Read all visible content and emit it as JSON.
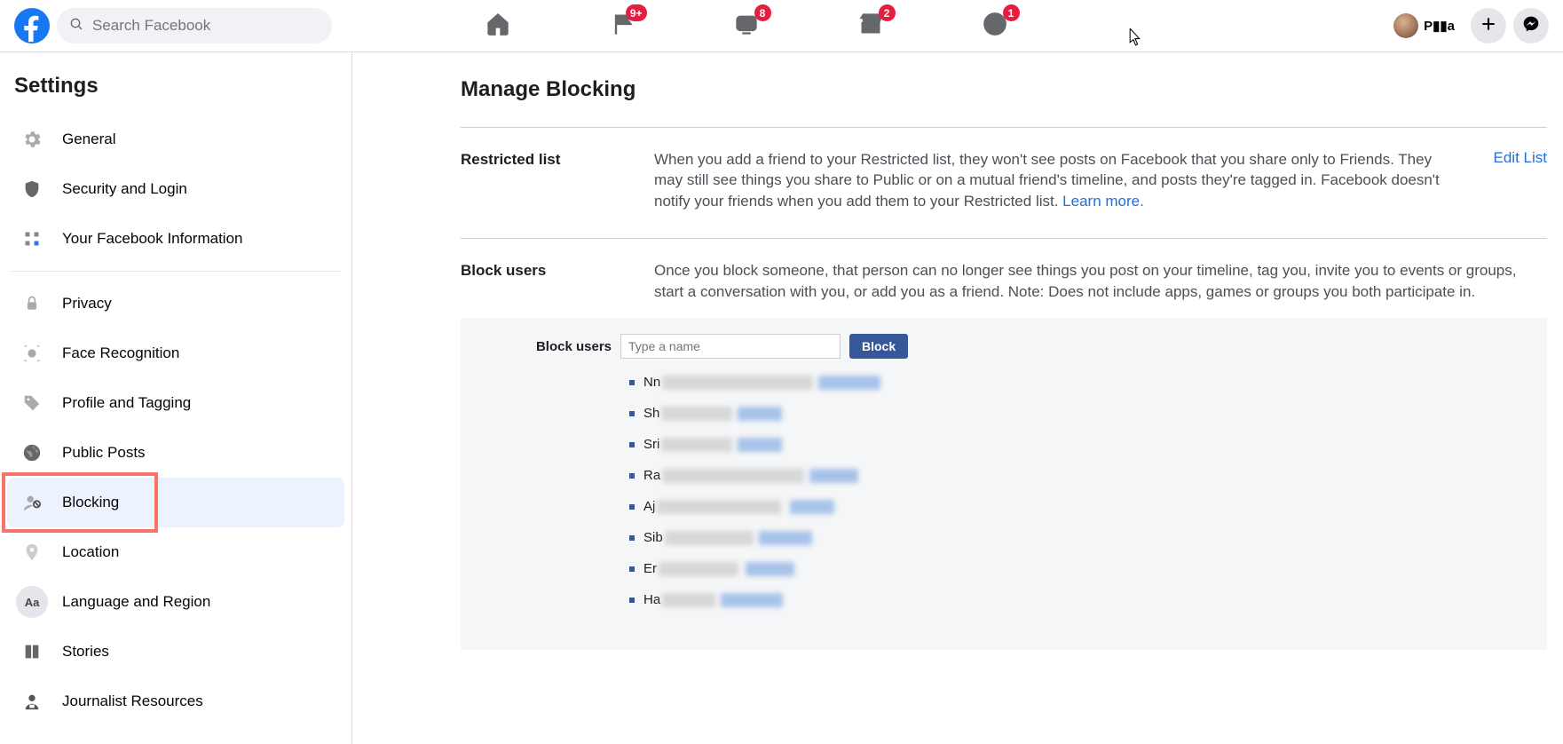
{
  "header": {
    "search_placeholder": "Search Facebook",
    "badges": {
      "pages": "9+",
      "watch": "8",
      "marketplace": "2",
      "groups": "1"
    },
    "profile_name": "P▮▮a"
  },
  "sidebar": {
    "title": "Settings",
    "items": [
      {
        "label": "General"
      },
      {
        "label": "Security and Login"
      },
      {
        "label": "Your Facebook Information"
      },
      {
        "label": "Privacy"
      },
      {
        "label": "Face Recognition"
      },
      {
        "label": "Profile and Tagging"
      },
      {
        "label": "Public Posts"
      },
      {
        "label": "Blocking"
      },
      {
        "label": "Location"
      },
      {
        "label": "Language and Region"
      },
      {
        "label": "Stories"
      },
      {
        "label": "Journalist Resources"
      }
    ]
  },
  "main": {
    "title": "Manage Blocking",
    "restricted": {
      "label": "Restricted list",
      "desc": "When you add a friend to your Restricted list, they won't see posts on Facebook that you share only to Friends. They may still see things you share to Public or on a mutual friend's timeline, and posts they're tagged in. Facebook doesn't notify your friends when you add them to your Restricted list. ",
      "learn_more": "Learn more.",
      "action": "Edit List"
    },
    "block_users": {
      "label": "Block users",
      "desc": "Once you block someone, that person can no longer see things you post on your timeline, tag you, invite you to events or groups, start a conversation with you, or add you as a friend. Note: Does not include apps, games or groups you both participate in.",
      "panel_label": "Block users",
      "placeholder": "Type a name",
      "button": "Block",
      "blocked_prefixes": [
        "Nn",
        "Sh",
        "Sri",
        "Ra",
        "Aj",
        "Sib",
        "Er",
        "Ha"
      ]
    }
  }
}
